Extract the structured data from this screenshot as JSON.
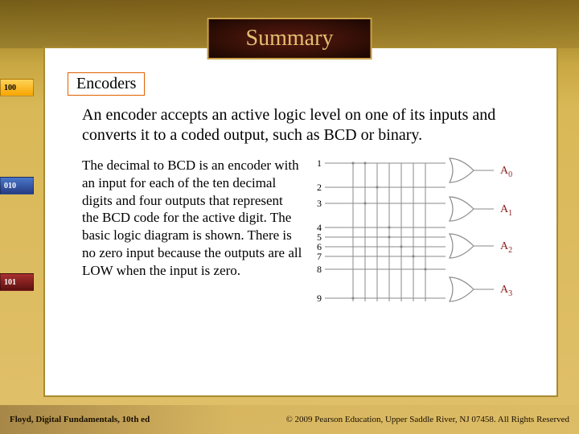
{
  "title": "Summary",
  "section_label": "Encoders",
  "lead_text": "An encoder accepts an active logic level on one of its inputs and converts it to a coded output, such as BCD or binary.",
  "detail_text": "The decimal to BCD is an encoder with an input for each of the ten decimal digits and four outputs that represent the BCD code for the active digit. The basic logic diagram is shown. There is no zero input because the outputs are all LOW when the input is zero.",
  "diagram": {
    "inputs": [
      "1",
      "2",
      "3",
      "4",
      "5",
      "6",
      "7",
      "8",
      "9"
    ],
    "outputs": [
      "A0",
      "A1",
      "A2",
      "A3"
    ]
  },
  "side_badges": [
    "100",
    "010",
    "101"
  ],
  "footer_left": "Floyd, Digital Fundamentals, 10th ed",
  "footer_right": "© 2009 Pearson Education, Upper Saddle River, NJ 07458. All Rights Reserved"
}
